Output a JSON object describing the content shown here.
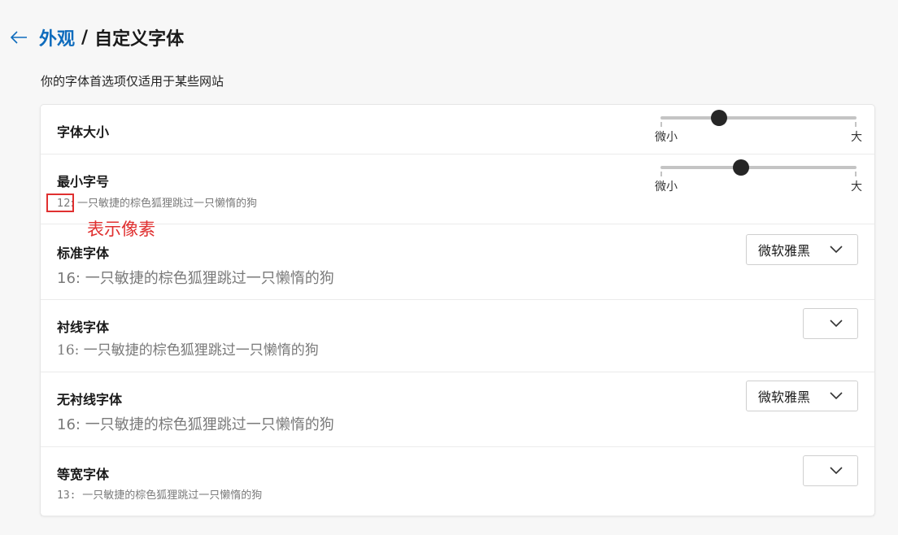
{
  "header": {
    "breadcrumb_parent": "外观",
    "separator": "/",
    "title": "自定义字体"
  },
  "subtitle": "你的字体首选项仅适用于某些网站",
  "font_size": {
    "label": "字体大小",
    "min_label": "微小",
    "max_label": "大",
    "value_fraction": 0.3
  },
  "min_font_size": {
    "label": "最小字号",
    "sample": "12: 一只敏捷的棕色狐狸跳过一只懒惰的狗",
    "min_label": "微小",
    "max_label": "大",
    "value_fraction": 0.41
  },
  "annotation": {
    "text": "表示像素",
    "color": "#e03030"
  },
  "standard_font": {
    "label": "标准字体",
    "sample": "16: 一只敏捷的棕色狐狸跳过一只懒惰的狗",
    "selected": "微软雅黑"
  },
  "serif_font": {
    "label": "衬线字体",
    "sample": "16: 一只敏捷的棕色狐狸跳过一只懒惰的狗",
    "selected": ""
  },
  "sans_serif_font": {
    "label": "无衬线字体",
    "sample": "16: 一只敏捷的棕色狐狸跳过一只懒惰的狗",
    "selected": "微软雅黑"
  },
  "monospace_font": {
    "label": "等宽字体",
    "sample": "13: 一只敏捷的棕色狐狸跳过一只懒惰的狗",
    "selected": ""
  },
  "colors": {
    "link": "#0f6cbd",
    "slider_thumb": "#262626",
    "annotation_red": "#e03030"
  }
}
